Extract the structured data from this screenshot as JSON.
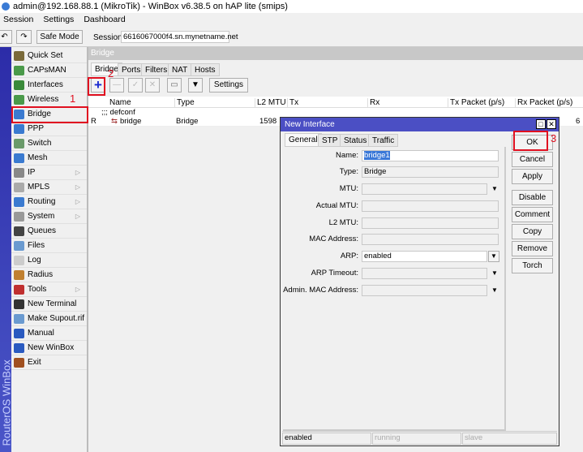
{
  "window": {
    "title": "admin@192.168.88.1 (MikroTik) - WinBox v6.38.5 on hAP lite (smips)"
  },
  "menu": [
    "Session",
    "Settings",
    "Dashboard"
  ],
  "toolbar": {
    "undo_icon": "undo-icon",
    "redo_icon": "redo-icon",
    "safe_mode": "Safe Mode",
    "session_label": "Session:",
    "session_value": "6616067000f4.sn.mynetname.net"
  },
  "stripe_text": "RouterOS WinBox",
  "sidebar": [
    {
      "label": "Quick Set",
      "color": "#7a6a3a"
    },
    {
      "label": "CAPsMAN",
      "color": "#4a9a4a"
    },
    {
      "label": "Interfaces",
      "color": "#3a8a3a"
    },
    {
      "label": "Wireless",
      "color": "#4a9a4a"
    },
    {
      "label": "Bridge",
      "color": "#3a7ad0",
      "selected": true
    },
    {
      "label": "PPP",
      "color": "#3a7ad0"
    },
    {
      "label": "Switch",
      "color": "#6a9a6a"
    },
    {
      "label": "Mesh",
      "color": "#3a7ad0"
    },
    {
      "label": "IP",
      "color": "#888",
      "sub": true
    },
    {
      "label": "MPLS",
      "color": "#aaa",
      "sub": true
    },
    {
      "label": "Routing",
      "color": "#3a7ad0",
      "sub": true
    },
    {
      "label": "System",
      "color": "#999",
      "sub": true
    },
    {
      "label": "Queues",
      "color": "#444"
    },
    {
      "label": "Files",
      "color": "#6a9ad0"
    },
    {
      "label": "Log",
      "color": "#ccc"
    },
    {
      "label": "Radius",
      "color": "#c08030"
    },
    {
      "label": "Tools",
      "color": "#c03030",
      "sub": true
    },
    {
      "label": "New Terminal",
      "color": "#333"
    },
    {
      "label": "Make Supout.rif",
      "color": "#6a9ad0"
    },
    {
      "label": "Manual",
      "color": "#2a5ac0"
    },
    {
      "label": "New WinBox",
      "color": "#2a5ac0"
    },
    {
      "label": "Exit",
      "color": "#a05020"
    }
  ],
  "bridge_panel": {
    "title": "Bridge",
    "tabs": [
      "Bridge",
      "Ports",
      "Filters",
      "NAT",
      "Hosts"
    ],
    "settings_label": "Settings",
    "columns": [
      "Name",
      "Type",
      "L2 MTU",
      "Tx",
      "Rx",
      "Tx Packet (p/s)",
      "Rx Packet (p/s)"
    ],
    "group": ";;; defconf",
    "rows": [
      {
        "flag": "R",
        "name": "bridge",
        "type": "Bridge",
        "l2mtu": "1598",
        "rxp": "6"
      }
    ]
  },
  "annotations": [
    "1",
    "2",
    "3"
  ],
  "dialog": {
    "title": "New Interface",
    "tabs": [
      "General",
      "STP",
      "Status",
      "Traffic"
    ],
    "fields": [
      {
        "label": "Name:",
        "value": "bridge1"
      },
      {
        "label": "Type:",
        "value": "Bridge"
      },
      {
        "label": "MTU:",
        "value": ""
      },
      {
        "label": "Actual MTU:",
        "value": ""
      },
      {
        "label": "L2 MTU:",
        "value": ""
      },
      {
        "label": "MAC Address:",
        "value": ""
      },
      {
        "label": "ARP:",
        "value": "enabled"
      },
      {
        "label": "ARP Timeout:",
        "value": ""
      },
      {
        "label": "Admin. MAC Address:",
        "value": ""
      }
    ],
    "buttons": [
      "OK",
      "Cancel",
      "Apply",
      "Disable",
      "Comment",
      "Copy",
      "Remove",
      "Torch"
    ],
    "status": [
      "enabled",
      "running",
      "slave"
    ]
  }
}
